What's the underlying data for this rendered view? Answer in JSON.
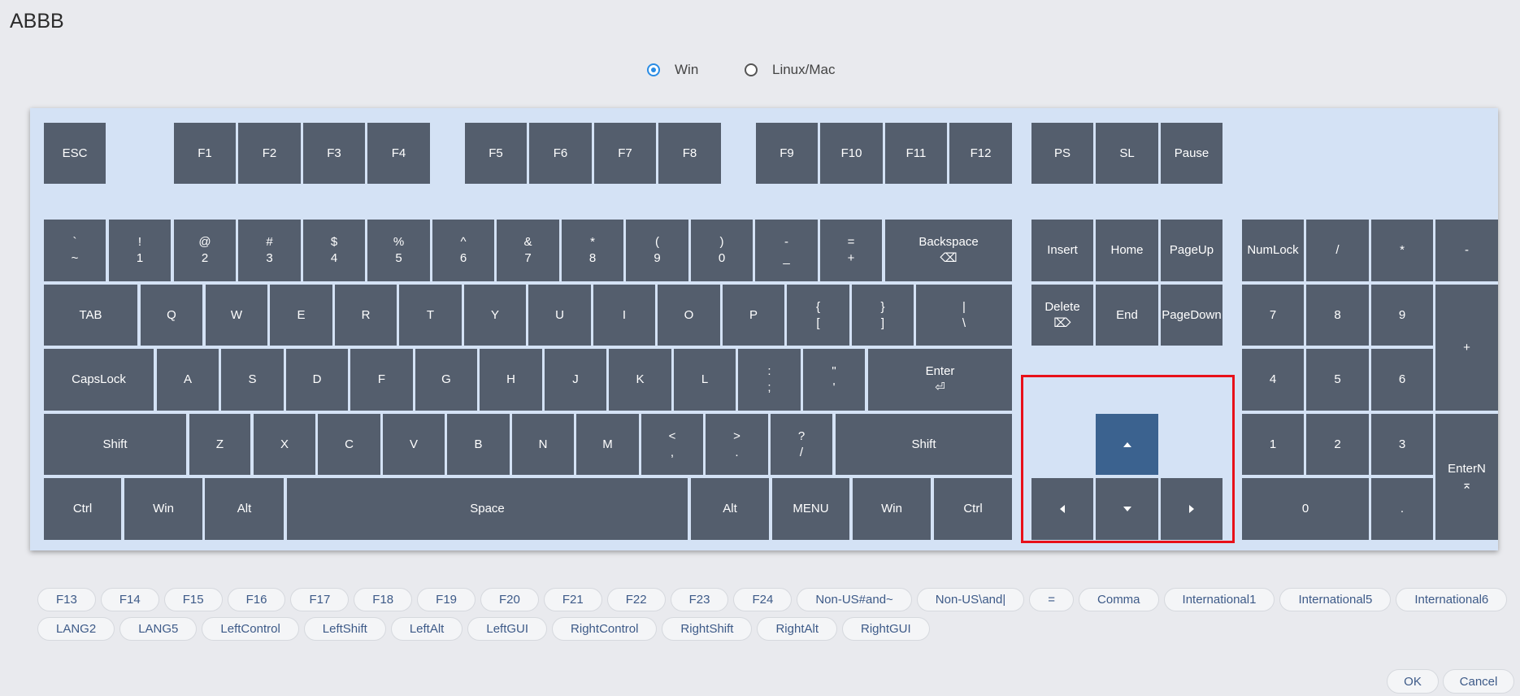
{
  "title": "ABBB",
  "os": {
    "options": [
      "Win",
      "Linux/Mac"
    ],
    "selected": "Win"
  },
  "keys": {
    "esc": "ESC",
    "f1": "F1",
    "f2": "F2",
    "f3": "F3",
    "f4": "F4",
    "f5": "F5",
    "f6": "F6",
    "f7": "F7",
    "f8": "F8",
    "f9": "F9",
    "f10": "F10",
    "f11": "F11",
    "f12": "F12",
    "ps": "PS",
    "sl": "SL",
    "pause": "Pause",
    "grave": [
      "`",
      "~"
    ],
    "n1": [
      "!",
      "1"
    ],
    "n2": [
      "@",
      "2"
    ],
    "n3": [
      "#",
      "3"
    ],
    "n4": [
      "$",
      "4"
    ],
    "n5": [
      "%",
      "5"
    ],
    "n6": [
      "^",
      "6"
    ],
    "n7": [
      "&",
      "7"
    ],
    "n8": [
      "*",
      "8"
    ],
    "n9": [
      "(",
      "9"
    ],
    "n0": [
      ")",
      "0"
    ],
    "minus": [
      "-",
      "_"
    ],
    "equal": [
      "=",
      "+"
    ],
    "backspace": [
      "Backspace",
      "⌫"
    ],
    "tab": "TAB",
    "q": "Q",
    "w": "W",
    "e": "E",
    "r": "R",
    "t": "T",
    "y": "Y",
    "u": "U",
    "i": "I",
    "o": "O",
    "p": "P",
    "lbracket": [
      "{",
      "["
    ],
    "rbracket": [
      "}",
      "]"
    ],
    "backslash": [
      "|",
      "\\"
    ],
    "capslock": "CapsLock",
    "a": "A",
    "s": "S",
    "d": "D",
    "f": "F",
    "g": "G",
    "h": "H",
    "j": "J",
    "k": "K",
    "l": "L",
    "semicolon": [
      ":",
      ";"
    ],
    "quote": [
      "\"",
      "'"
    ],
    "enter": [
      "Enter",
      "⏎"
    ],
    "lshift": "Shift",
    "z": "Z",
    "x": "X",
    "c": "C",
    "v": "V",
    "b": "B",
    "n": "N",
    "m": "M",
    "comma": [
      "<",
      ","
    ],
    "period": [
      ">",
      "."
    ],
    "slash": [
      "?",
      "/"
    ],
    "rshift": "Shift",
    "lctrl": "Ctrl",
    "lwin": "Win",
    "lalt": "Alt",
    "space": "Space",
    "ralt": "Alt",
    "menu": "MENU",
    "rwin": "Win",
    "rctrl": "Ctrl",
    "insert": "Insert",
    "home": "Home",
    "pageup": "PageUp",
    "delete": [
      "Delete",
      "⌦"
    ],
    "end": "End",
    "pagedown": "PageDown",
    "numlock": "NumLock",
    "kpslash": "/",
    "kpstar": "*",
    "kpminus": "-",
    "kp7": "7",
    "kp8": "8",
    "kp9": "9",
    "kpplus": "+",
    "kp4": "4",
    "kp5": "5",
    "kp6": "6",
    "kp1": "1",
    "kp2": "2",
    "kp3": "3",
    "kpenter": [
      "EnterN",
      "⌅"
    ],
    "kp0": "0",
    "kpdot": "."
  },
  "extra_keys_row1": [
    "F13",
    "F14",
    "F15",
    "F16",
    "F17",
    "F18",
    "F19",
    "F20",
    "F21",
    "F22",
    "F23",
    "F24",
    "Non-US#and~",
    "Non-US\\and|",
    "=",
    "Comma",
    "International1",
    "International5",
    "International6"
  ],
  "extra_keys_row2": [
    "LANG2",
    "LANG5",
    "LeftControl",
    "LeftShift",
    "LeftAlt",
    "LeftGUI",
    "RightControl",
    "RightShift",
    "RightAlt",
    "RightGUI"
  ],
  "buttons": {
    "ok": "OK",
    "cancel": "Cancel"
  },
  "colors": {
    "key": "#545e6d",
    "selected_key": "#3b628f",
    "keyboard_bg": "#d4e2f5",
    "highlight": "#e8101a",
    "radio_accent": "#2a8ce4",
    "chip_text": "#3d5a88"
  }
}
